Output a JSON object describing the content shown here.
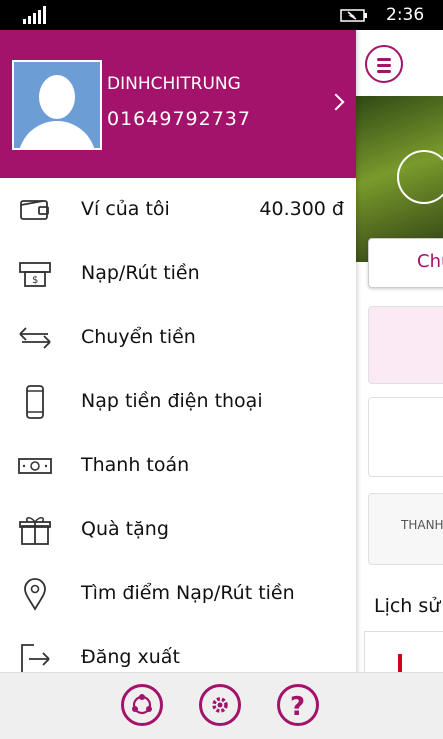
{
  "status_bar": {
    "time": "2:36"
  },
  "background": {
    "chu_button": "Chu",
    "card3_text": "THANH",
    "history_label": "Lịch sử"
  },
  "profile": {
    "name": "DINHCHITRUNG",
    "phone": "01649792737"
  },
  "menu": [
    {
      "label": "Ví của tôi",
      "value": "40.300 đ",
      "icon": "wallet-icon"
    },
    {
      "label": "Nạp/Rút tiền",
      "icon": "cash-terminal-icon"
    },
    {
      "label": "Chuyển tiền",
      "icon": "transfer-arrows-icon"
    },
    {
      "label": "Nạp tiền điện thoại",
      "icon": "smartphone-icon"
    },
    {
      "label": "Thanh toán",
      "icon": "banknote-icon"
    },
    {
      "label": "Quà tặng",
      "icon": "gift-icon"
    },
    {
      "label": "Tìm điểm Nạp/Rút tiền",
      "icon": "location-pin-icon"
    },
    {
      "label": "Đăng xuất",
      "icon": "logout-icon"
    }
  ],
  "colors": {
    "brand": "#a3136b"
  }
}
